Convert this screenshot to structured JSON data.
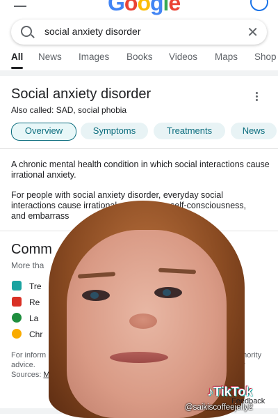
{
  "header": {
    "logo_letters": [
      "G",
      "o",
      "o",
      "g",
      "l",
      "e"
    ],
    "menu_icon": "hamburger-icon",
    "account_icon": "account-circle-icon"
  },
  "search": {
    "query": "social anxiety disorder",
    "search_icon": "search-icon",
    "clear_icon": "close-icon"
  },
  "tabs": [
    "All",
    "News",
    "Images",
    "Books",
    "Videos",
    "Maps",
    "Shop"
  ],
  "active_tab": "All",
  "knowledge_panel": {
    "title": "Social anxiety disorder",
    "also_called": "Also called: SAD, social phobia",
    "chips": [
      "Overview",
      "Symptoms",
      "Treatments",
      "News"
    ],
    "active_chip": "Overview",
    "description_1": "A chronic mental health condition in which social interactions cause irrational anxiety.",
    "description_2_line1": "For people with social anxiety disorder, everyday social",
    "description_2_line2": "interactions cause irrational anxiety, fear, self-consciousness,",
    "description_2_line3": "and embarrass"
  },
  "common_section": {
    "title": "Comm",
    "subtitle": "More tha",
    "items": [
      {
        "label": "Tre",
        "icon": "medicine-bottle-icon",
        "color": "#1aa3a0"
      },
      {
        "label": "Re",
        "icon": "calendar-icon",
        "color": "#d93025"
      },
      {
        "label": "La",
        "icon": "lab-test-icon",
        "color": "#1e8e3e"
      },
      {
        "label": "Chr",
        "icon": "clock-icon",
        "color": "#f9ab00"
      }
    ]
  },
  "footer": {
    "info_left": "For inform",
    "info_right": "uthority for",
    "advice": "advice.",
    "sources_label": "Sources: ",
    "sources_link": "M",
    "feedback": "Feedback"
  },
  "watermark": {
    "brand": "TikTok",
    "handle": "@saikiscoffeejelly2"
  },
  "colors": {
    "chip_bg": "#e8f3f5",
    "chip_text": "#0b6d7e",
    "google_blue": "#4285f4"
  }
}
